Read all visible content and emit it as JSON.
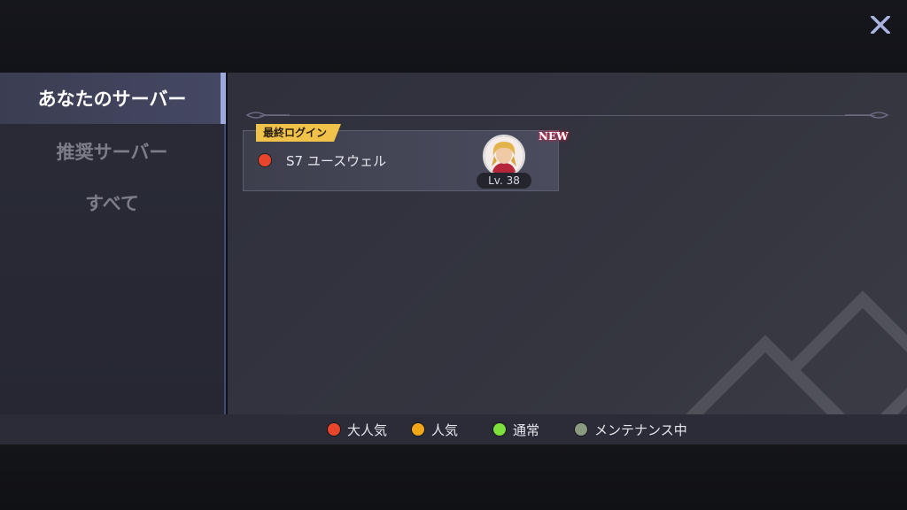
{
  "sidebar": {
    "items": [
      {
        "label": "あなたのサーバー",
        "active": true
      },
      {
        "label": "推奨サーバー",
        "active": false
      },
      {
        "label": "すべて",
        "active": false
      }
    ]
  },
  "server_card": {
    "tag": "最終ログイン",
    "name": "S7 ユースウェル",
    "level": "Lv. 38",
    "new_label": "NEW",
    "status_color": "#e8462a"
  },
  "legend": [
    {
      "label": "大人気",
      "color": "#e8462a"
    },
    {
      "label": "人気",
      "color": "#f0a818"
    },
    {
      "label": "通常",
      "color": "#7ee03c"
    },
    {
      "label": "メンテナンス中",
      "color": "#8a9a80"
    }
  ],
  "icons": {
    "close": "close-icon"
  }
}
